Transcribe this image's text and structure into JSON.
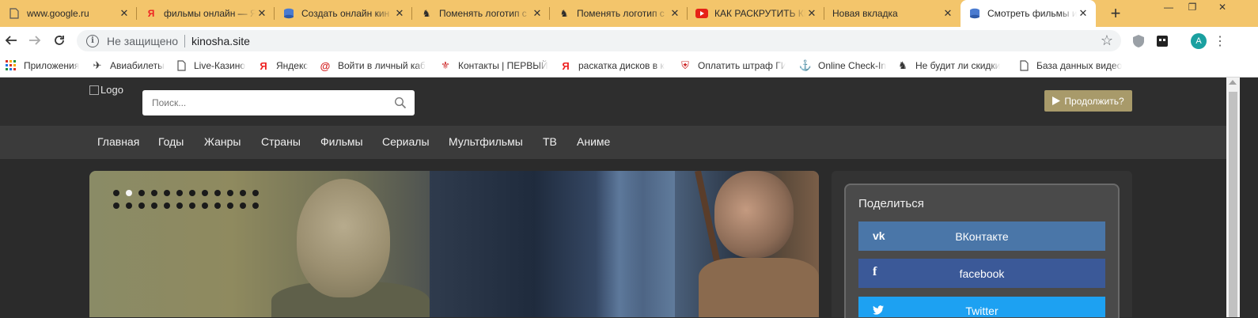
{
  "tabs": [
    {
      "title": "www.google.ru",
      "icon": "page-icon"
    },
    {
      "title": "фильмы онлайн — Я",
      "icon": "yandex-icon"
    },
    {
      "title": "Создать онлайн кин",
      "icon": "database-icon"
    },
    {
      "title": "Поменять логотип с",
      "icon": "knight-icon"
    },
    {
      "title": "Поменять логотип с",
      "icon": "knight-icon"
    },
    {
      "title": "КАК РАСКРУТИТЬ КИ",
      "icon": "youtube-icon"
    },
    {
      "title": "Новая вкладка",
      "icon": "none"
    },
    {
      "title": "Смотреть фильмы и",
      "icon": "database-icon",
      "active": true
    }
  ],
  "toolbar": {
    "security_label": "Не защищено",
    "url": "kinosha.site",
    "profile_initial": "A"
  },
  "bookmarks": [
    {
      "label": "Приложения",
      "icon": "apps-icon"
    },
    {
      "label": "Авиабилеты",
      "icon": "plane-icon"
    },
    {
      "label": "Live-Казино",
      "icon": "page-icon"
    },
    {
      "label": "Яндекс",
      "icon": "yandex-icon"
    },
    {
      "label": "Войти в личный каб",
      "icon": "at-icon"
    },
    {
      "label": "Контакты | ПЕРВЫЙ",
      "icon": "crest-icon"
    },
    {
      "label": "раскатка дисков в к",
      "icon": "yandex-icon"
    },
    {
      "label": "Оплатить штраф ГИБ",
      "icon": "shield-icon"
    },
    {
      "label": "Online Check-In",
      "icon": "ship-icon"
    },
    {
      "label": "Не будит ли скидки",
      "icon": "knight-icon"
    },
    {
      "label": "База данных видео",
      "icon": "page-icon"
    }
  ],
  "site": {
    "logo_alt": "Logo",
    "search_placeholder": "Поиск...",
    "continue_label": "Продолжить?",
    "nav": [
      "Главная",
      "Годы",
      "Жанры",
      "Страны",
      "Фильмы",
      "Сериалы",
      "Мультфильмы",
      "ТВ",
      "Аниме"
    ],
    "slider": {
      "total_slides": 24,
      "active_index": 1
    },
    "share": {
      "title": "Поделиться",
      "buttons": [
        {
          "label": "ВКонтакте",
          "icon": "vk-icon",
          "color": "#4a76a8"
        },
        {
          "label": "facebook",
          "icon": "facebook-icon",
          "color": "#3b5998"
        },
        {
          "label": "Twitter",
          "icon": "twitter-icon",
          "color": "#1da1f2"
        }
      ]
    }
  }
}
